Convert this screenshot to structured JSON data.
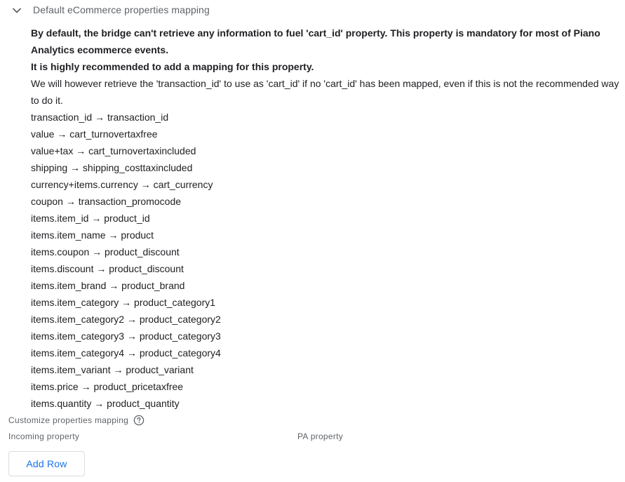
{
  "section": {
    "title": "Default eCommerce properties mapping",
    "expanded": true,
    "chevron_icon": "chevron-down-icon"
  },
  "notice": {
    "bold_line_1": "By default, the bridge can't retrieve any information to fuel 'cart_id' property. This property is mandatory for most of Piano Analytics ecommerce events.",
    "bold_line_2": "It is highly recommended to add a mapping for this property.",
    "normal_line": "We will however retrieve the 'transaction_id' to use as 'cart_id' if no 'cart_id' has been mapped, even if this is not the recommended way to do it."
  },
  "mappings": [
    "transaction_id → transaction_id",
    "value → cart_turnovertaxfree",
    "value+tax → cart_turnovertaxincluded",
    "shipping → shipping_costtaxincluded",
    "currency+items.currency → cart_currency",
    "coupon → transaction_promocode",
    "items.item_id → product_id",
    "items.item_name → product",
    "items.coupon → product_discount",
    "items.discount → product_discount",
    "items.item_brand → product_brand",
    "items.item_category → product_category1",
    "items.item_category2 → product_category2",
    "items.item_category3 → product_category3",
    "items.item_category4 → product_category4",
    "items.item_variant → product_variant",
    "items.price → product_pricetaxfree",
    "items.quantity → product_quantity"
  ],
  "customize": {
    "label": "Customize properties mapping",
    "help_icon": "help-circle-icon",
    "columns": {
      "incoming": "Incoming property",
      "pa": "PA property"
    },
    "add_row_label": "Add Row"
  },
  "colors": {
    "accent": "#1a73e8",
    "secondary_text": "#5f6368",
    "primary_text": "#202124",
    "border": "#dadce0"
  }
}
